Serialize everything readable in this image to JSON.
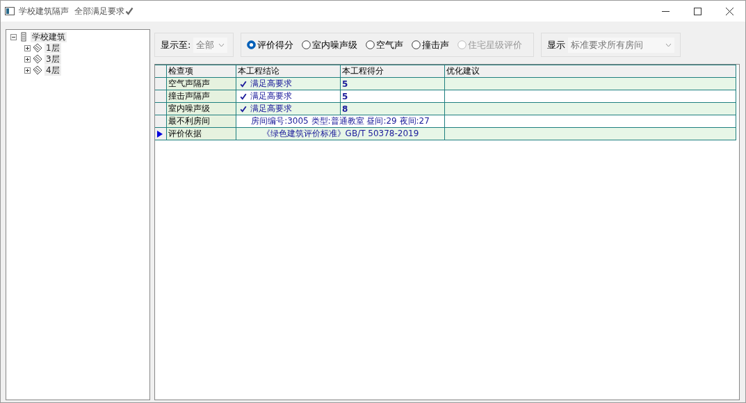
{
  "window": {
    "title": "学校建筑隔声",
    "subtitle": "全部满足要求"
  },
  "tree": {
    "label": "学校建筑",
    "expanded": true,
    "children": [
      {
        "label": "1层",
        "expanded": false
      },
      {
        "label": "3层",
        "expanded": false
      },
      {
        "label": "4层",
        "expanded": false
      }
    ]
  },
  "filters": {
    "show_to": {
      "label": "显示至:",
      "value": "全部"
    },
    "modes": [
      {
        "label": "评价得分",
        "selected": true,
        "disabled": false
      },
      {
        "label": "室内噪声级",
        "selected": false,
        "disabled": false
      },
      {
        "label": "空气声",
        "selected": false,
        "disabled": false
      },
      {
        "label": "撞击声",
        "selected": false,
        "disabled": false
      },
      {
        "label": "住宅星级评价",
        "selected": false,
        "disabled": true
      }
    ],
    "display": {
      "label": "显示",
      "value": "标准要求所有房间"
    }
  },
  "table": {
    "columns": [
      "检查项",
      "本工程结论",
      "本工程得分",
      "优化建议"
    ],
    "rows": [
      {
        "kind": "result",
        "item": "空气声隔声",
        "conclusion": "满足高要求",
        "checked": true,
        "score": "5",
        "current": false
      },
      {
        "kind": "result",
        "item": "撞击声隔声",
        "conclusion": "满足高要求",
        "checked": true,
        "score": "5",
        "current": false
      },
      {
        "kind": "result",
        "item": "室内噪声级",
        "conclusion": "满足高要求",
        "checked": true,
        "score": "8",
        "current": false
      },
      {
        "kind": "info",
        "item": "最不利房间",
        "text": "房间编号:3005 类型:普通教室 昼间:29 夜间:27",
        "current": false
      },
      {
        "kind": "info",
        "item": "评价依据",
        "text": "《绿色建筑评价标准》GB/T 50378-2019",
        "current": true
      }
    ]
  }
}
